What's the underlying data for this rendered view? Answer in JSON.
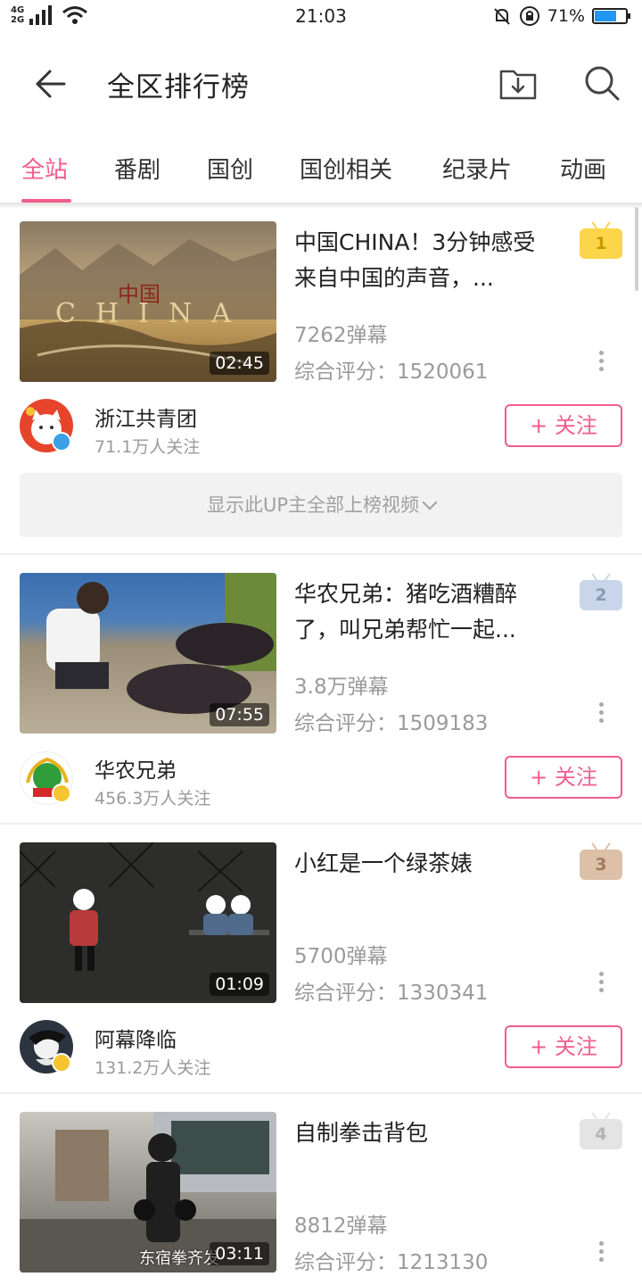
{
  "status_bar": {
    "network_top": "4G",
    "network_bottom": "2G",
    "time": "21:03",
    "battery": "71%",
    "battery_level": 0.71
  },
  "header": {
    "title": "全区排行榜",
    "back_icon": "arrow-left-icon",
    "download_icon": "download-folder-icon",
    "search_icon": "search-icon"
  },
  "tabs": [
    {
      "label": "全站",
      "active": true
    },
    {
      "label": "番剧",
      "active": false
    },
    {
      "label": "国创",
      "active": false
    },
    {
      "label": "国创相关",
      "active": false
    },
    {
      "label": "纪录片",
      "active": false
    },
    {
      "label": "动画",
      "active": false
    }
  ],
  "colors": {
    "accent": "#f25d8e",
    "rank1": "#fbd54a",
    "rank2": "#c9d6ea",
    "rank3": "#dcc0a8",
    "rank4": "#e4e4e4"
  },
  "videos": [
    {
      "rank": "1",
      "title": "中国CHINA！3分钟感受来自中国的声音，...",
      "thumb_text_top": "中国",
      "thumb_text_bottom": "CHINA",
      "duration": "02:45",
      "danmaku": "7262弹幕",
      "score": "综合评分：1520061",
      "uploader": "浙江共青团",
      "followers": "71.1万人关注",
      "follow_label": "+ 关注",
      "show_all": "显示此UP主全部上榜视频"
    },
    {
      "rank": "2",
      "title": "华农兄弟：猪吃酒糟醉了，叫兄弟帮忙一起...",
      "duration": "07:55",
      "danmaku": "3.8万弹幕",
      "score": "综合评分：1509183",
      "uploader": "华农兄弟",
      "followers": "456.3万人关注",
      "follow_label": "+ 关注"
    },
    {
      "rank": "3",
      "title": "小红是一个绿茶婊",
      "duration": "01:09",
      "danmaku": "5700弹幕",
      "score": "综合评分：1330341",
      "uploader": "阿幕降临",
      "followers": "131.2万人关注",
      "follow_label": "+ 关注"
    },
    {
      "rank": "4",
      "title": "自制拳击背包",
      "thumb_caption": "东宿拳齐发",
      "duration": "03:11",
      "danmaku": "8812弹幕",
      "score": "综合评分：1213130"
    }
  ]
}
